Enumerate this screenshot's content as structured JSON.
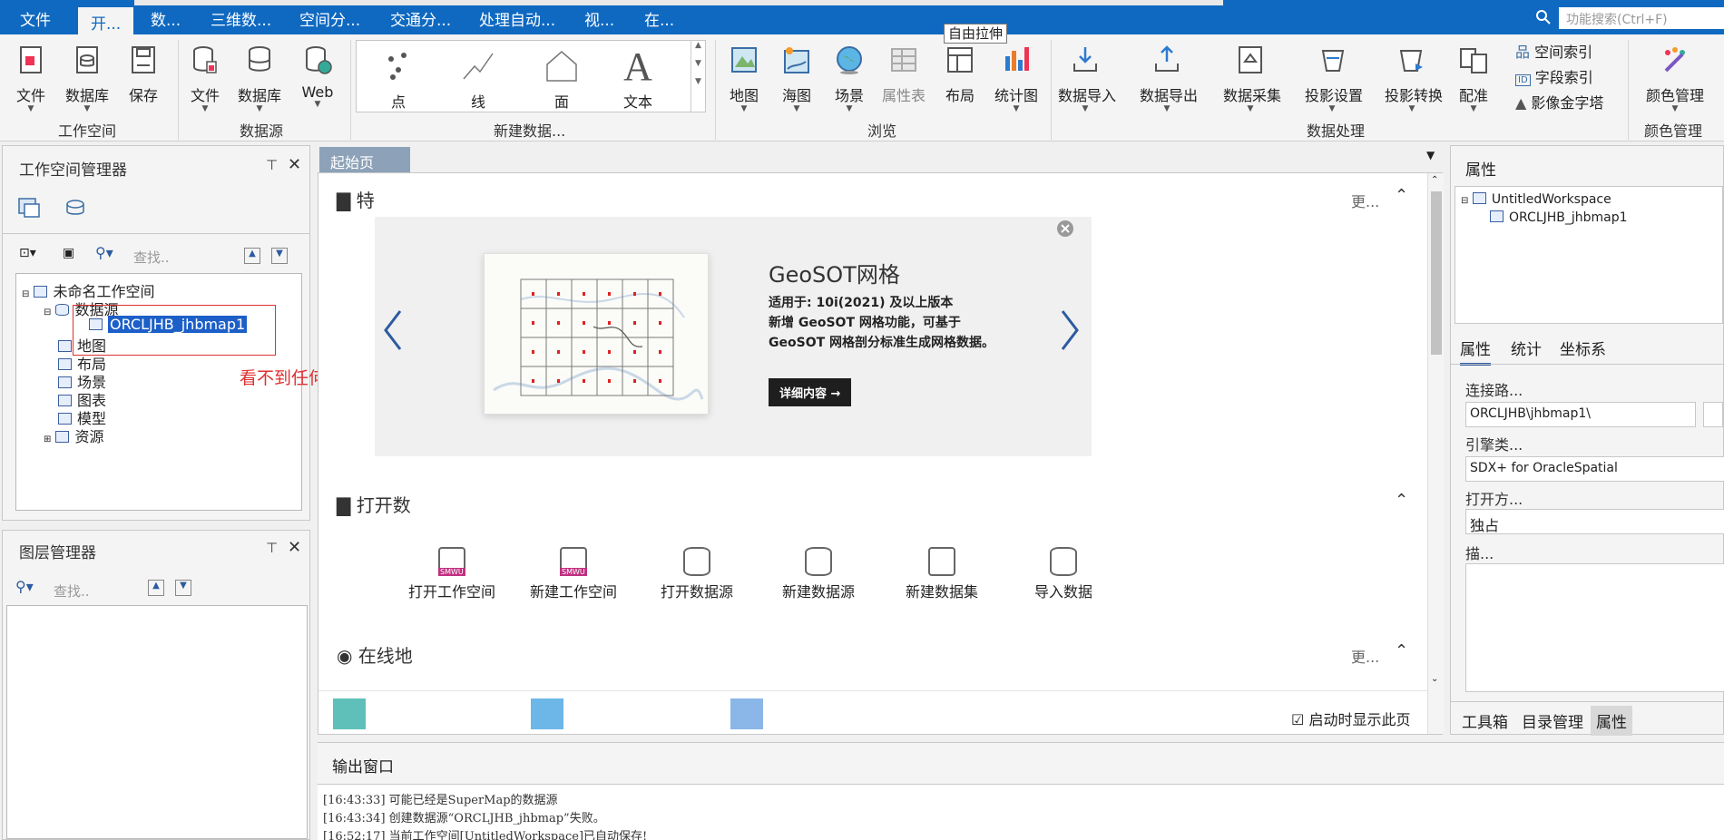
{
  "menu": {
    "items": [
      "文件",
      "开...",
      "数...",
      "三维数...",
      "空间分...",
      "交通分...",
      "处理自动...",
      "视...",
      "在..."
    ],
    "search_placeholder": "功能搜索(Ctrl+F)"
  },
  "ribbon": {
    "workspace": {
      "file": "文件",
      "database": "数据库",
      "save": "保存",
      "group": "工作空间"
    },
    "datasource": {
      "file": "文件",
      "database": "数据库",
      "web": "Web",
      "group": "数据源"
    },
    "newdata": {
      "point": "点",
      "line": "线",
      "face": "面",
      "text": "文本",
      "group": "新建数据..."
    },
    "browse": {
      "map": "地图",
      "chart": "海图",
      "scene": "场景",
      "attr": "属性表",
      "layout": "布局",
      "stat": "统计图",
      "group": "浏览"
    },
    "tooltip": "自由拉伸",
    "dataproc": {
      "import": "数据导入",
      "export": "数据导出",
      "collect": "数据采集",
      "proj_set": "投影设置",
      "proj_conv": "投影转换",
      "register": "配准",
      "spatial_index": "空间索引",
      "field_index": "字段索引",
      "pyramid": "影像金字塔",
      "group": "数据处理"
    },
    "color": {
      "manage": "颜色管理",
      "group": "颜色管理"
    }
  },
  "workspace_panel": {
    "title": "工作空间管理器",
    "search_placeholder": "查找..",
    "tree": {
      "root": "未命名工作空间",
      "datasource": "数据源",
      "selected": "ORCLJHB_jhbmap1",
      "map": "地图",
      "layout": "布局",
      "scene": "场景",
      "chart": "图表",
      "model": "模型",
      "resource": "资源"
    },
    "annotation": "看不到任何数据"
  },
  "layer_panel": {
    "title": "图层管理器",
    "search_placeholder": "查找.."
  },
  "center": {
    "tab": "起始页",
    "featured": {
      "title": "特",
      "more": "更..."
    },
    "banner": {
      "title": "GeoSOT网格",
      "line1": "适用于: 10i(2021) 及以上版本",
      "line2": "新增 GeoSOT 网格功能，可基于",
      "line3": "GeoSOT 网格剖分标准生成网格数据。",
      "button": "详细内容 →"
    },
    "open_section": {
      "title": "打开数"
    },
    "quick_actions": [
      "打开工作空间",
      "新建工作空间",
      "打开数据源",
      "新建数据源",
      "新建数据集",
      "导入数据"
    ],
    "online": {
      "title": "在线地",
      "more": "更..."
    },
    "show_on_start": "启动时显示此页"
  },
  "right_panel": {
    "title": "属性",
    "tree_root": "UntitledWorkspace",
    "tree_child": "ORCLJHB_jhbmap1",
    "tabs": [
      "属性",
      "统计",
      "坐标系"
    ],
    "conn_label": "连接路...",
    "conn_value": "ORCLJHB\\jhbmap1\\",
    "engine_label": "引擎类...",
    "engine_value": "SDX+ for OracleSpatial",
    "open_label": "打开方...",
    "open_value": "独占",
    "desc_label": "描...",
    "bottom_tabs": [
      "工具箱",
      "目录管理",
      "属性"
    ]
  },
  "output": {
    "title": "输出窗口",
    "lines": [
      "[16:43:33] 可能已经是SuperMap的数据源",
      "[16:43:34] 创建数据源“ORCLJHB_jhbmap”失败。",
      "[16:52:17] 当前工作空间[UntitledWorkspace]已自动保存!"
    ]
  }
}
